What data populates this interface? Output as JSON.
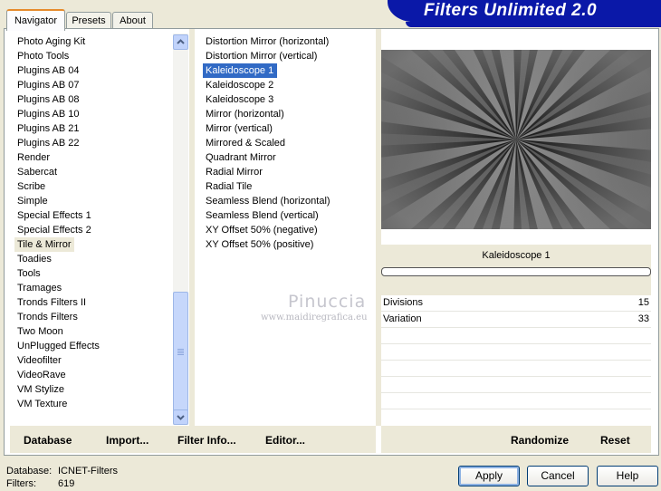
{
  "tabs": [
    {
      "label": "Navigator"
    },
    {
      "label": "Presets"
    },
    {
      "label": "About"
    }
  ],
  "banner": {
    "title": "Filters Unlimited 2.0"
  },
  "categories": [
    "Photo Aging Kit",
    "Photo Tools",
    "Plugins AB 04",
    "Plugins AB 07",
    "Plugins AB 08",
    "Plugins AB 10",
    "Plugins AB 21",
    "Plugins AB 22",
    "Render",
    "Sabercat",
    "Scribe",
    "Simple",
    "Special Effects 1",
    "Special Effects 2",
    "Tile & Mirror",
    "Toadies",
    "Tools",
    "Tramages",
    "Tronds Filters II",
    "Tronds Filters",
    "Two Moon",
    "UnPlugged Effects",
    "Videofilter",
    "VideoRave",
    "VM Stylize",
    "VM Texture"
  ],
  "selected_category": "Tile & Mirror",
  "filters": [
    "Distortion Mirror (horizontal)",
    "Distortion Mirror (vertical)",
    "Kaleidoscope 1",
    "Kaleidoscope 2",
    "Kaleidoscope 3",
    "Mirror (horizontal)",
    "Mirror (vertical)",
    "Mirrored & Scaled",
    "Quadrant Mirror",
    "Radial Mirror",
    "Radial Tile",
    "Seamless Blend (horizontal)",
    "Seamless Blend (vertical)",
    "XY Offset 50% (negative)",
    "XY Offset 50% (positive)"
  ],
  "selected_filter": "Kaleidoscope 1",
  "filter_title": "Kaleidoscope 1",
  "params": [
    {
      "label": "Divisions",
      "value": "15"
    },
    {
      "label": "Variation",
      "value": "33"
    }
  ],
  "toolbar": {
    "database": "Database",
    "import": "Import...",
    "filter_info": "Filter Info...",
    "editor": "Editor...",
    "randomize": "Randomize",
    "reset": "Reset"
  },
  "status": {
    "database_label": "Database:",
    "database_value": "ICNET-Filters",
    "filters_label": "Filters:",
    "filters_value": "619"
  },
  "buttons": {
    "apply": "Apply",
    "cancel": "Cancel",
    "help": "Help"
  },
  "watermark": {
    "name": "Pinuccia",
    "url": "www.maidiregrafica.eu"
  },
  "colors": {
    "selection": "#316ac5",
    "banner": "#0a18a8",
    "tab_accent": "#e68b2c"
  }
}
